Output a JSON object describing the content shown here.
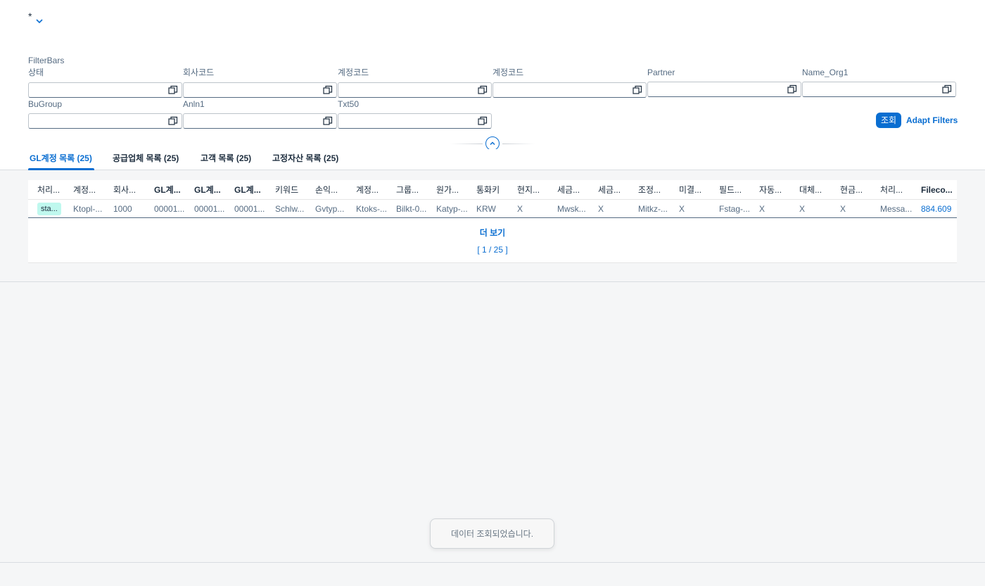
{
  "page": {
    "title_marker": "*",
    "filterbar_title": "FilterBars"
  },
  "filters": [
    {
      "label": "상태"
    },
    {
      "label": "회사코드"
    },
    {
      "label": "계정코드"
    },
    {
      "label": "계정코드"
    },
    {
      "label": "Partner"
    },
    {
      "label": "Name_Org1"
    },
    {
      "label": "BuGroup"
    },
    {
      "label": "Anln1"
    },
    {
      "label": "Txt50"
    }
  ],
  "actions": {
    "go_label": "조회",
    "adapt_label": "Adapt Filters"
  },
  "tabs": [
    {
      "label": "GL계정 목록 (25)",
      "active": true
    },
    {
      "label": "공급업체 목록 (25)",
      "active": false
    },
    {
      "label": "고객 목록 (25)",
      "active": false
    },
    {
      "label": "고정자산 목록 (25)",
      "active": false
    }
  ],
  "table": {
    "headers": [
      "처리...",
      "계정...",
      "회사...",
      "GL계...",
      "GL계...",
      "GL계...",
      "키워드",
      "손익...",
      "계정...",
      "그룹...",
      "원가...",
      "통화키",
      "현지...",
      "세금...",
      "세금...",
      "조정...",
      "미결...",
      "필드...",
      "자동...",
      "대체...",
      "현금...",
      "처리...",
      "Fileco..."
    ],
    "row": [
      "sta...",
      "Ktopl-...",
      "1000",
      "00001...",
      "00001...",
      "00001...",
      "Schlw...",
      "Gvtyp...",
      "Ktoks-...",
      "Bilkt-0...",
      "Katyp-...",
      "KRW",
      "X",
      "Mwsk...",
      "X",
      "",
      "Mitkz-...",
      "X",
      "Fstag-...",
      "X",
      "X",
      "X",
      "Messa...",
      "884.609"
    ],
    "more_label": "더 보기",
    "pager_label": "[ 1 / 25 ]"
  },
  "toast": {
    "message": "데이터 조회되었습니다."
  },
  "colors": {
    "brand": "#0a6ed1",
    "status_badge": "#bff8ee"
  }
}
